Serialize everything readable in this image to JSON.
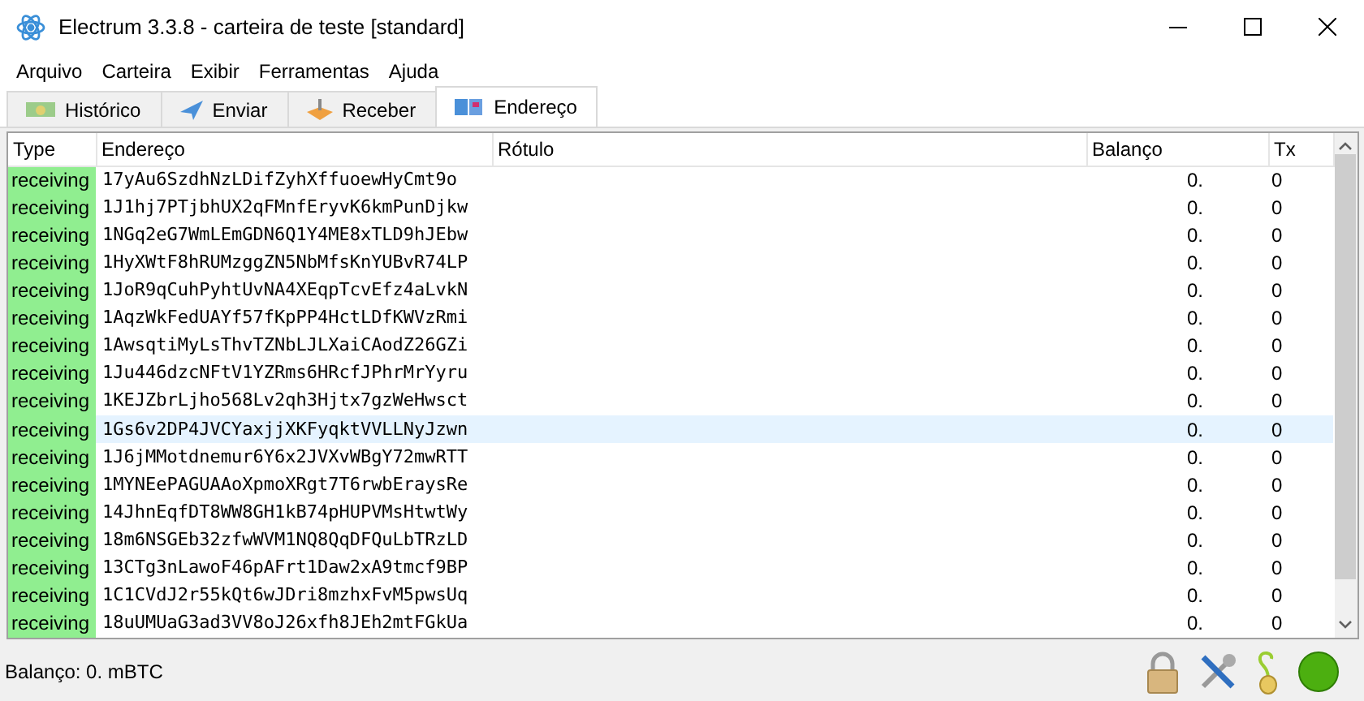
{
  "window": {
    "title": "Electrum 3.3.8  -  carteira de teste  [standard]"
  },
  "menu": [
    "Arquivo",
    "Carteira",
    "Exibir",
    "Ferramentas",
    "Ajuda"
  ],
  "tabs": [
    {
      "label": "Histórico",
      "selected": false,
      "kind": "history"
    },
    {
      "label": "Enviar",
      "selected": false,
      "kind": "send"
    },
    {
      "label": "Receber",
      "selected": false,
      "kind": "receive"
    },
    {
      "label": "Endereço",
      "selected": true,
      "kind": "addresses"
    }
  ],
  "table": {
    "columns": [
      "Type",
      "Endereço",
      "Rótulo",
      "Balanço",
      "Tx"
    ],
    "rows": [
      {
        "type": "receiving",
        "color": "#90ee90",
        "address": "17yAu6SzdhNzLDifZyhXffuoewHyCmt9o",
        "balance": "0.",
        "tx": "0",
        "selected": false
      },
      {
        "type": "receiving",
        "color": "#90ee90",
        "address": "1J1hj7PTjbhUX2qFMnfEryvK6kmPunDjkw",
        "balance": "0.",
        "tx": "0",
        "selected": false
      },
      {
        "type": "receiving",
        "color": "#90ee90",
        "address": "1NGq2eG7WmLEmGDN6Q1Y4ME8xTLD9hJEbw",
        "balance": "0.",
        "tx": "0",
        "selected": false
      },
      {
        "type": "receiving",
        "color": "#90ee90",
        "address": "1HyXWtF8hRUMzggZN5NbMfsKnYUBvR74LP",
        "balance": "0.",
        "tx": "0",
        "selected": false
      },
      {
        "type": "receiving",
        "color": "#90ee90",
        "address": "1JoR9qCuhPyhtUvNA4XEqpTcvEfz4aLvkN",
        "balance": "0.",
        "tx": "0",
        "selected": false
      },
      {
        "type": "receiving",
        "color": "#90ee90",
        "address": "1AqzWkFedUAYf57fKpPP4HctLDfKWVzRmi",
        "balance": "0.",
        "tx": "0",
        "selected": false
      },
      {
        "type": "receiving",
        "color": "#90ee90",
        "address": "1AwsqtiMyLsThvTZNbLJLXaiCAodZ26GZi",
        "balance": "0.",
        "tx": "0",
        "selected": false
      },
      {
        "type": "receiving",
        "color": "#90ee90",
        "address": "1Ju446dzcNFtV1YZRms6HRcfJPhrMrYyru",
        "balance": "0.",
        "tx": "0",
        "selected": false
      },
      {
        "type": "receiving",
        "color": "#90ee90",
        "address": "1KEJZbrLjho568Lv2qh3Hjtx7gzWeHwsct",
        "balance": "0.",
        "tx": "0",
        "selected": false
      },
      {
        "type": "receiving",
        "color": "#90ee90",
        "address": "1Gs6v2DP4JVCYaxjjXKFyqktVVLLNyJzwn",
        "balance": "0.",
        "tx": "0",
        "selected": true
      },
      {
        "type": "receiving",
        "color": "#90ee90",
        "address": "1J6jMMotdnemur6Y6x2JVXvWBgY72mwRTT",
        "balance": "0.",
        "tx": "0",
        "selected": false
      },
      {
        "type": "receiving",
        "color": "#90ee90",
        "address": "1MYNEePAGUAAoXpmoXRgt7T6rwbEraysRe",
        "balance": "0.",
        "tx": "0",
        "selected": false
      },
      {
        "type": "receiving",
        "color": "#90ee90",
        "address": "14JhnEqfDT8WW8GH1kB74pHUPVMsHtwtWy",
        "balance": "0.",
        "tx": "0",
        "selected": false
      },
      {
        "type": "receiving",
        "color": "#90ee90",
        "address": "18m6NSGEb32zfwWVM1NQ8QqDFQuLbTRzLD",
        "balance": "0.",
        "tx": "0",
        "selected": false
      },
      {
        "type": "receiving",
        "color": "#90ee90",
        "address": "13CTg3nLawoF46pAFrt1Daw2xA9tmcf9BP",
        "balance": "0.",
        "tx": "0",
        "selected": false
      },
      {
        "type": "receiving",
        "color": "#90ee90",
        "address": "1C1CVdJ2r55kQt6wJDri8mzhxFvM5pwsUq",
        "balance": "0.",
        "tx": "0",
        "selected": false
      },
      {
        "type": "receiving",
        "color": "#90ee90",
        "address": "18uUMUaG3ad3VV8oJ26xfh8JEh2mtFGkUa",
        "balance": "0.",
        "tx": "0",
        "selected": false
      }
    ]
  },
  "status_bar": {
    "balance": "Balanço: 0. mBTC"
  }
}
